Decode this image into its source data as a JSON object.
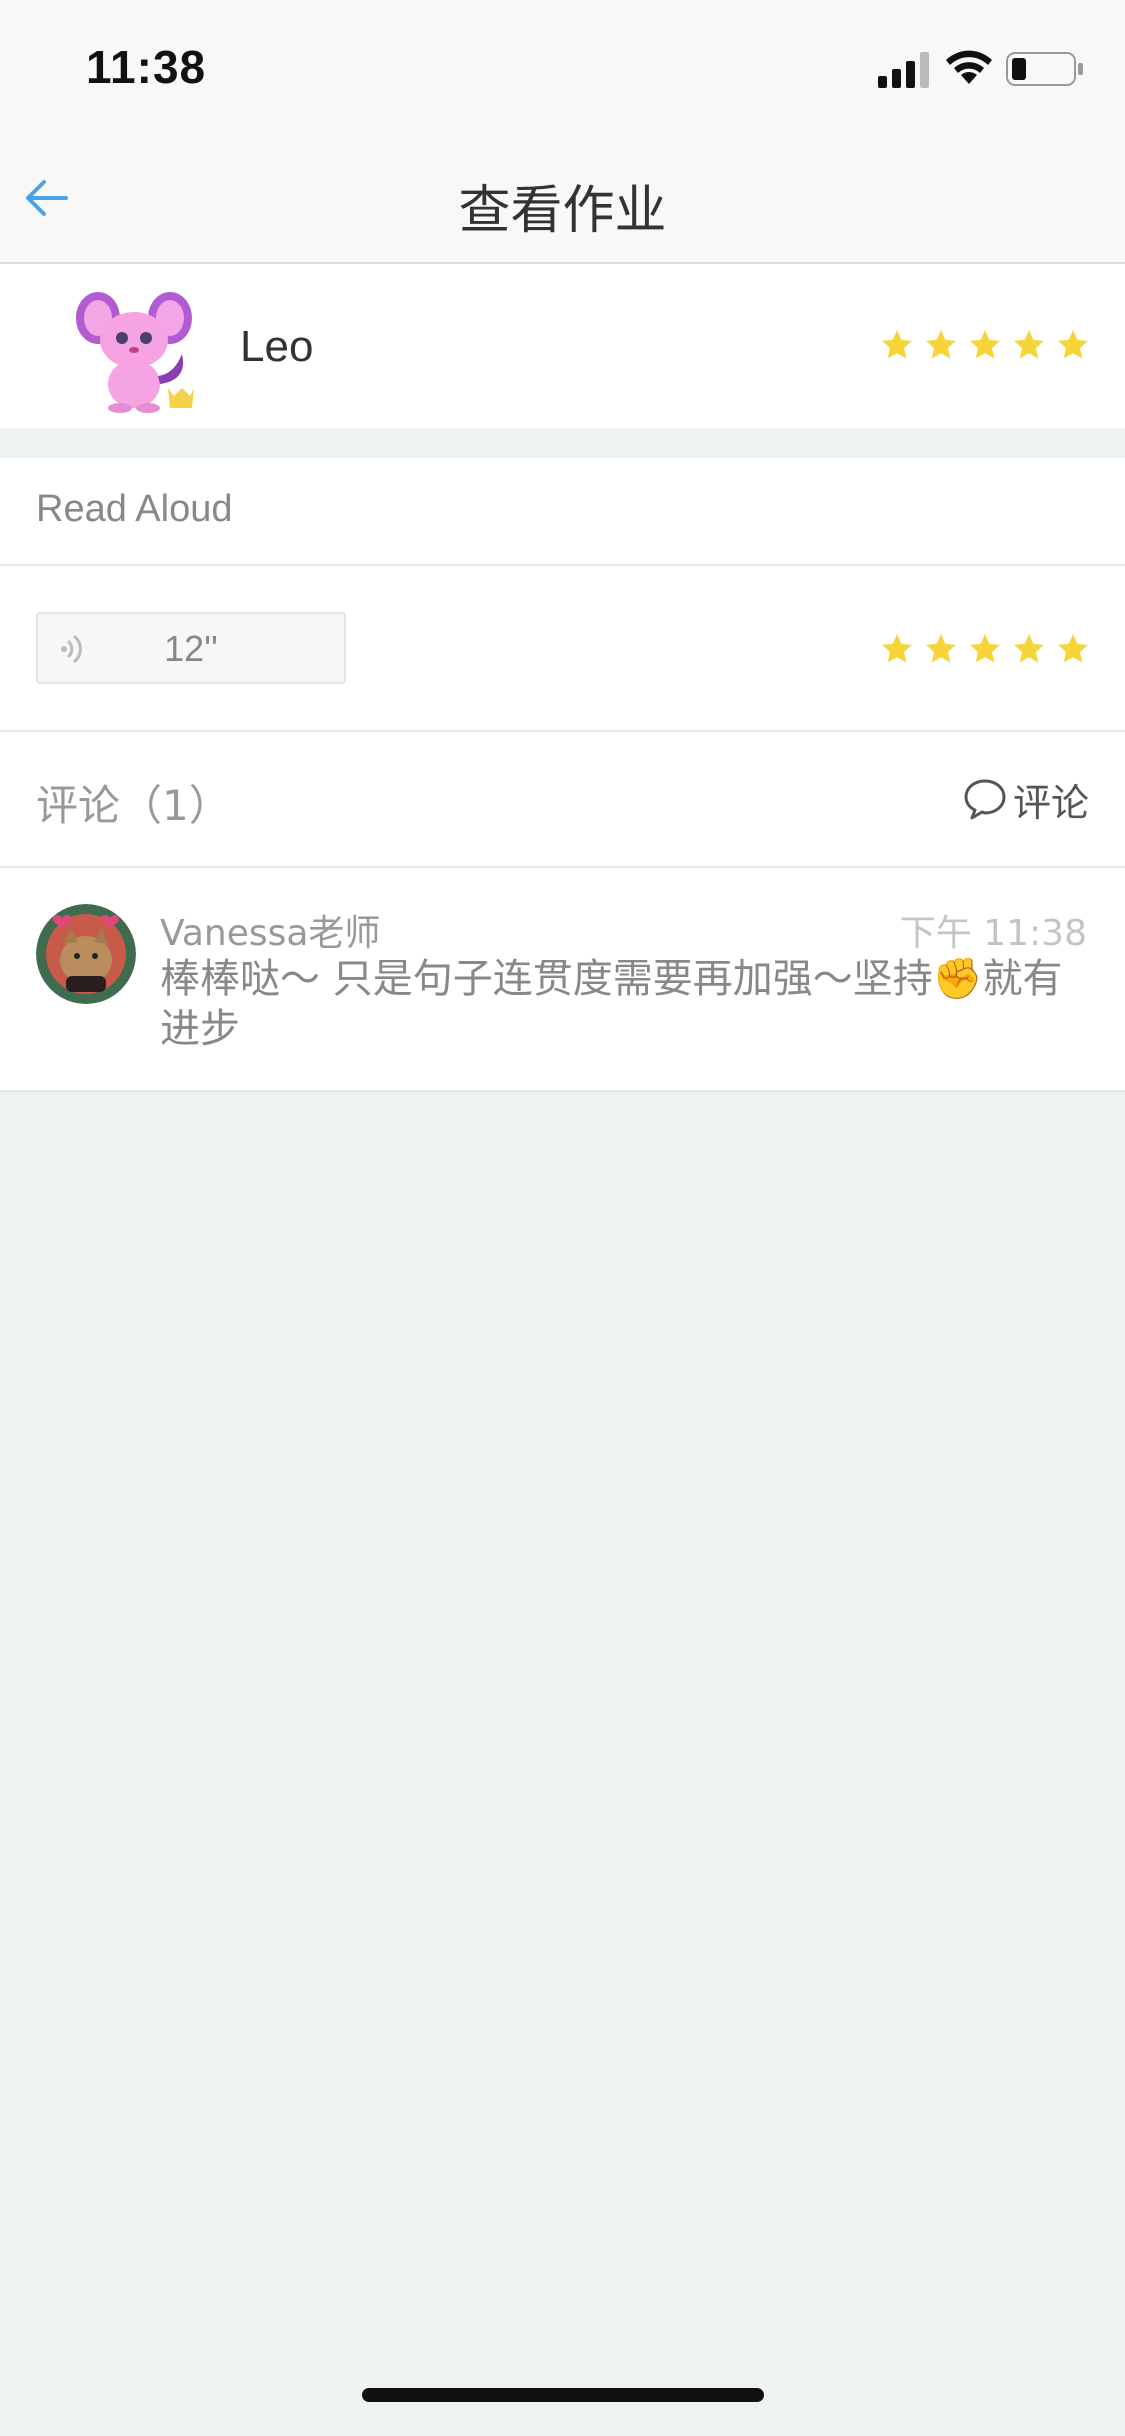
{
  "status_bar": {
    "time": "11:38"
  },
  "nav": {
    "title": "查看作业",
    "back_icon": "arrow-left-icon"
  },
  "student": {
    "name": "Leo",
    "rating": 5,
    "max_rating": 5
  },
  "task": {
    "title": "Read Aloud",
    "audio_duration": "12''",
    "rating": 5,
    "max_rating": 5
  },
  "comments": {
    "header": "评论（1）",
    "add_label": "评论",
    "items": [
      {
        "author": "Vanessa老师",
        "time": "下午 11:38",
        "text": "棒棒哒～ 只是句子连贯度需要再加强～坚持✊就有进步"
      }
    ]
  },
  "colors": {
    "accent": "#4aa3e8",
    "star": "#f7d539",
    "background": "#eff2f3"
  }
}
